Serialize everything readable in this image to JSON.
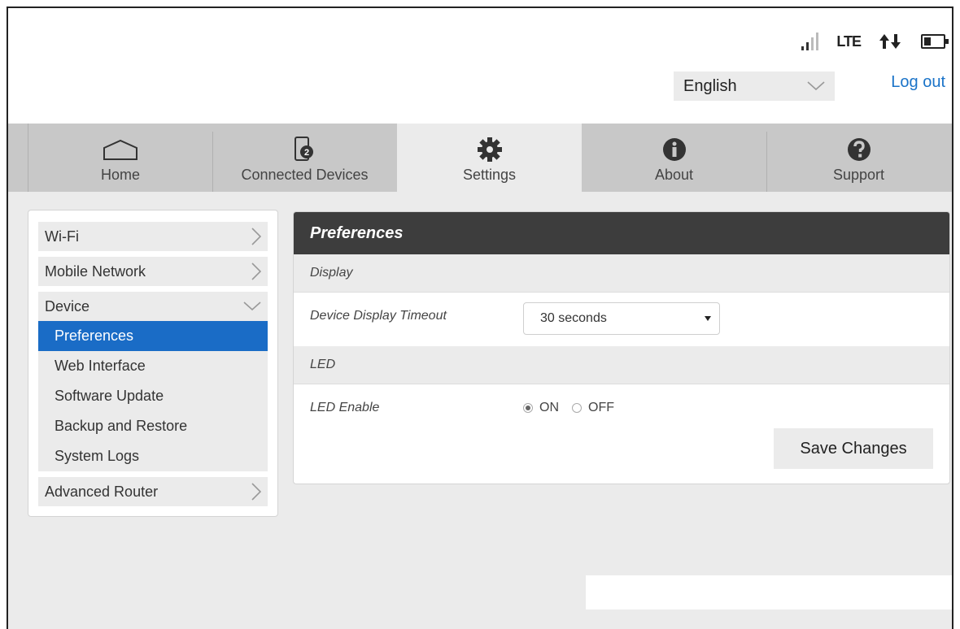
{
  "header": {
    "status": {
      "network_type": "LTE"
    },
    "language": {
      "selected": "English"
    },
    "logout_label": "Log out"
  },
  "nav": {
    "tabs": [
      {
        "label": "Home",
        "icon": "home-icon"
      },
      {
        "label": "Connected Devices",
        "icon": "connected-devices-icon",
        "badge": "2"
      },
      {
        "label": "Settings",
        "icon": "gear-icon",
        "active": true
      },
      {
        "label": "About",
        "icon": "info-icon"
      },
      {
        "label": "Support",
        "icon": "help-icon"
      }
    ]
  },
  "sidebar": {
    "items": [
      {
        "label": "Wi-Fi"
      },
      {
        "label": "Mobile Network"
      },
      {
        "label": "Device",
        "expanded": true,
        "children": [
          "Preferences",
          "Web Interface",
          "Software Update",
          "Backup and Restore",
          "System Logs"
        ],
        "active_child": "Preferences"
      },
      {
        "label": "Advanced Router"
      }
    ]
  },
  "panel": {
    "title": "Preferences",
    "display_section": "Display",
    "timeout_label": "Device Display Timeout",
    "timeout_value": "30 seconds",
    "led_section": "LED",
    "led_label": "LED Enable",
    "led_on_label": "ON",
    "led_off_label": "OFF",
    "led_selected": "ON",
    "save_label": "Save Changes"
  },
  "colors": {
    "accent": "#1a6cc6",
    "link": "#1a73c8",
    "panel_header": "#3d3d3d",
    "nav_bg": "#c8c8c8"
  }
}
